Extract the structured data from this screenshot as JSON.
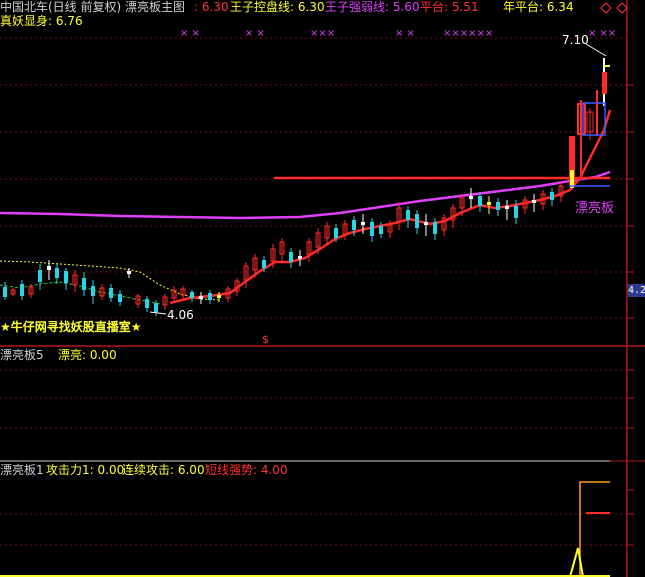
{
  "colors": {
    "background": "#000000",
    "grid": "#7a0d0d",
    "magenta": "#e040fb",
    "red": "#ff2b2b",
    "yellow": "#ffff33",
    "white": "#ffffff",
    "cyan": "#26d5e6",
    "green": "#2ecc40",
    "rail_badge": "#2b3a8f"
  },
  "header": {
    "row1": [
      {
        "text": "中国北车(日线 前复权) 漂亮板主图",
        "color": "#d0d0d0"
      },
      {
        "text": ": 6.30",
        "color": "#ff3333"
      },
      {
        "text": "王子控盘线: 6.30",
        "color": "#ffff33"
      },
      {
        "text": "王子强弱线: 5.60",
        "color": "#e040fb"
      },
      {
        "text": "平台: 5.51",
        "color": "#ff3333"
      },
      {
        "text": "年平台: 6.34",
        "color": "#ffff33"
      }
    ],
    "row2": {
      "text": "真妖显身: 6.76",
      "color": "#ffff33"
    }
  },
  "main_chart": {
    "high_label": "7.10",
    "low_label": "4.06",
    "signal_label": "漂亮板",
    "promo_text": "★牛仔网寻找妖股直播室★",
    "marker_glyph": "$",
    "x_marker_groups": [
      "× ×",
      "× ×",
      "×××",
      "× ×",
      "××××××",
      "× ××"
    ],
    "price_badge": "4.2"
  },
  "panel2": {
    "label_name": "漂亮板5",
    "label_value": "漂亮: 0.00"
  },
  "panel3": {
    "label_name": "漂亮板1",
    "label_attack": "攻击力1: 0.00",
    "label_continuous": "连续攻击: 6.00",
    "label_trend": "短线强势: 4.00"
  }
}
